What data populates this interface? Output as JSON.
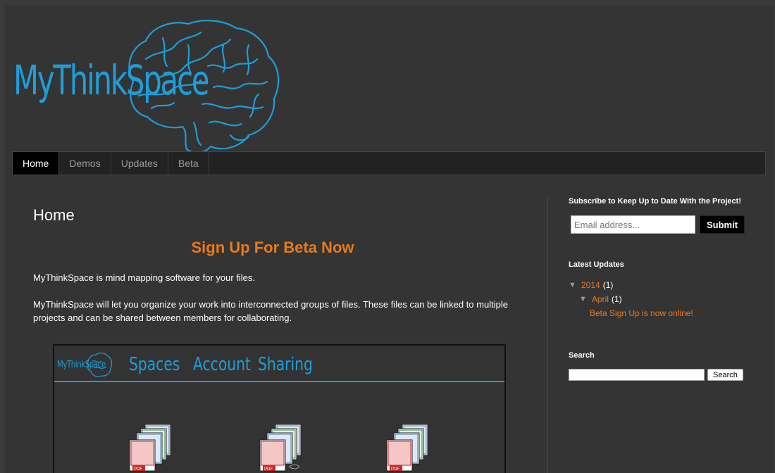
{
  "header": {
    "logo_text": "MyThinkSpace"
  },
  "nav": {
    "tabs": [
      "Home",
      "Demos",
      "Updates",
      "Beta"
    ],
    "active": "Home"
  },
  "main": {
    "page_title": "Home",
    "beta_link": "Sign Up For Beta Now",
    "paragraphs": [
      "MyThinkSpace is mind mapping software for your files.",
      "MyThinkSpace will let you organize your work into interconnected groups of files. These files can be linked to multiple projects and can be shared between members for collaborating."
    ],
    "screenshot": {
      "logo_text": "MyThinkSpace",
      "tabs": [
        "Spaces",
        "Account",
        "Sharing"
      ],
      "file_badge": "PDF"
    }
  },
  "sidebar": {
    "subscribe": {
      "title": "Subscribe to Keep Up to Date With the Project!",
      "email_placeholder": "Email address...",
      "submit_label": "Submit"
    },
    "latest": {
      "title": "Latest Updates",
      "year": "2014",
      "year_count": "(1)",
      "month": "April",
      "month_count": "(1)",
      "post": "Beta Sign Up is now online!",
      "toggle_icon": "▼"
    },
    "search": {
      "title": "Search",
      "button_label": "Search"
    }
  },
  "colors": {
    "accent_blue": "#1d9ed8",
    "link_orange": "#e87a1c",
    "background": "#343434"
  }
}
